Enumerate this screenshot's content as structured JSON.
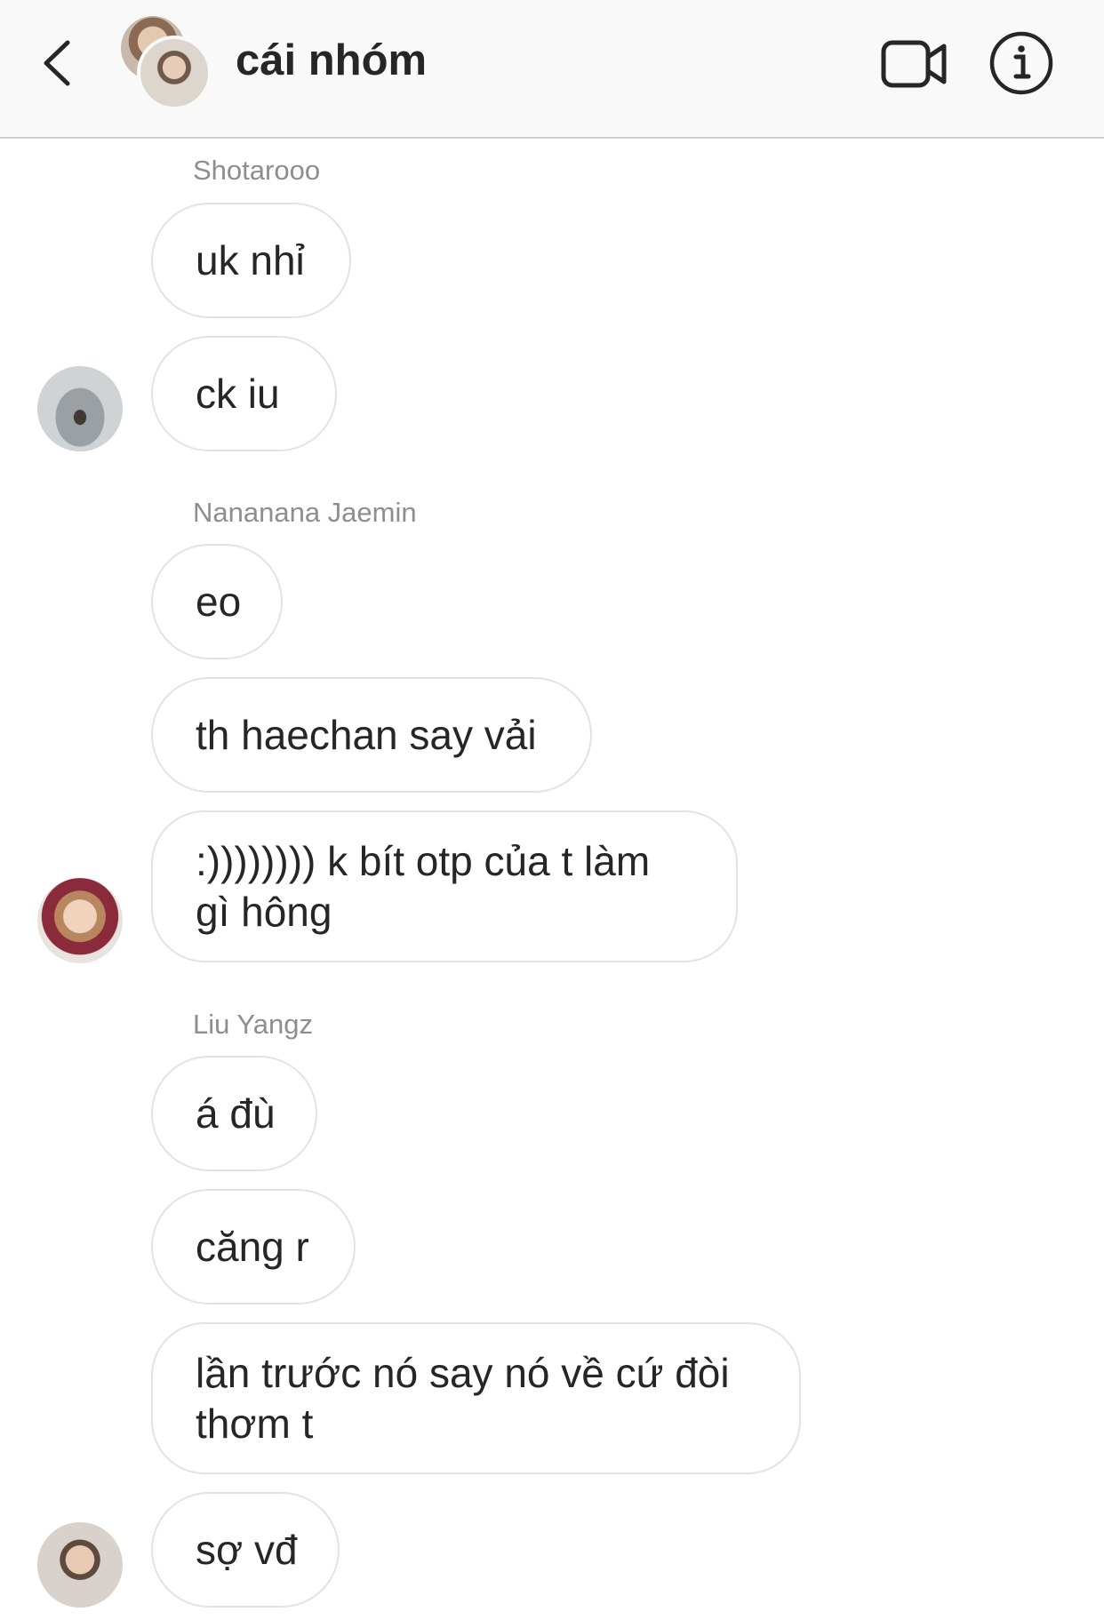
{
  "header": {
    "title": "cái nhóm",
    "back_icon": "chevron-left-icon",
    "video_icon": "video-camera-icon",
    "info_icon": "info-icon"
  },
  "messages": [
    {
      "sender": "Shotarooo",
      "bubbles": [
        "uk nhỉ",
        "ck iu"
      ]
    },
    {
      "sender": "Nananana Jaemin",
      "bubbles": [
        "eo",
        "th haechan say vải",
        ":)))))))) k bít otp của t làm gì hông"
      ]
    },
    {
      "sender": "Liu Yangz",
      "bubbles": [
        "á đù",
        "căng r",
        "lần trước nó say nó về cứ đòi thơm t",
        "sợ vđ"
      ]
    }
  ],
  "colors": {
    "header_bg": "#f9f9f9",
    "bubble_border": "#e3e3e3",
    "sender_text": "#8e8e8e",
    "message_text": "#262626"
  }
}
